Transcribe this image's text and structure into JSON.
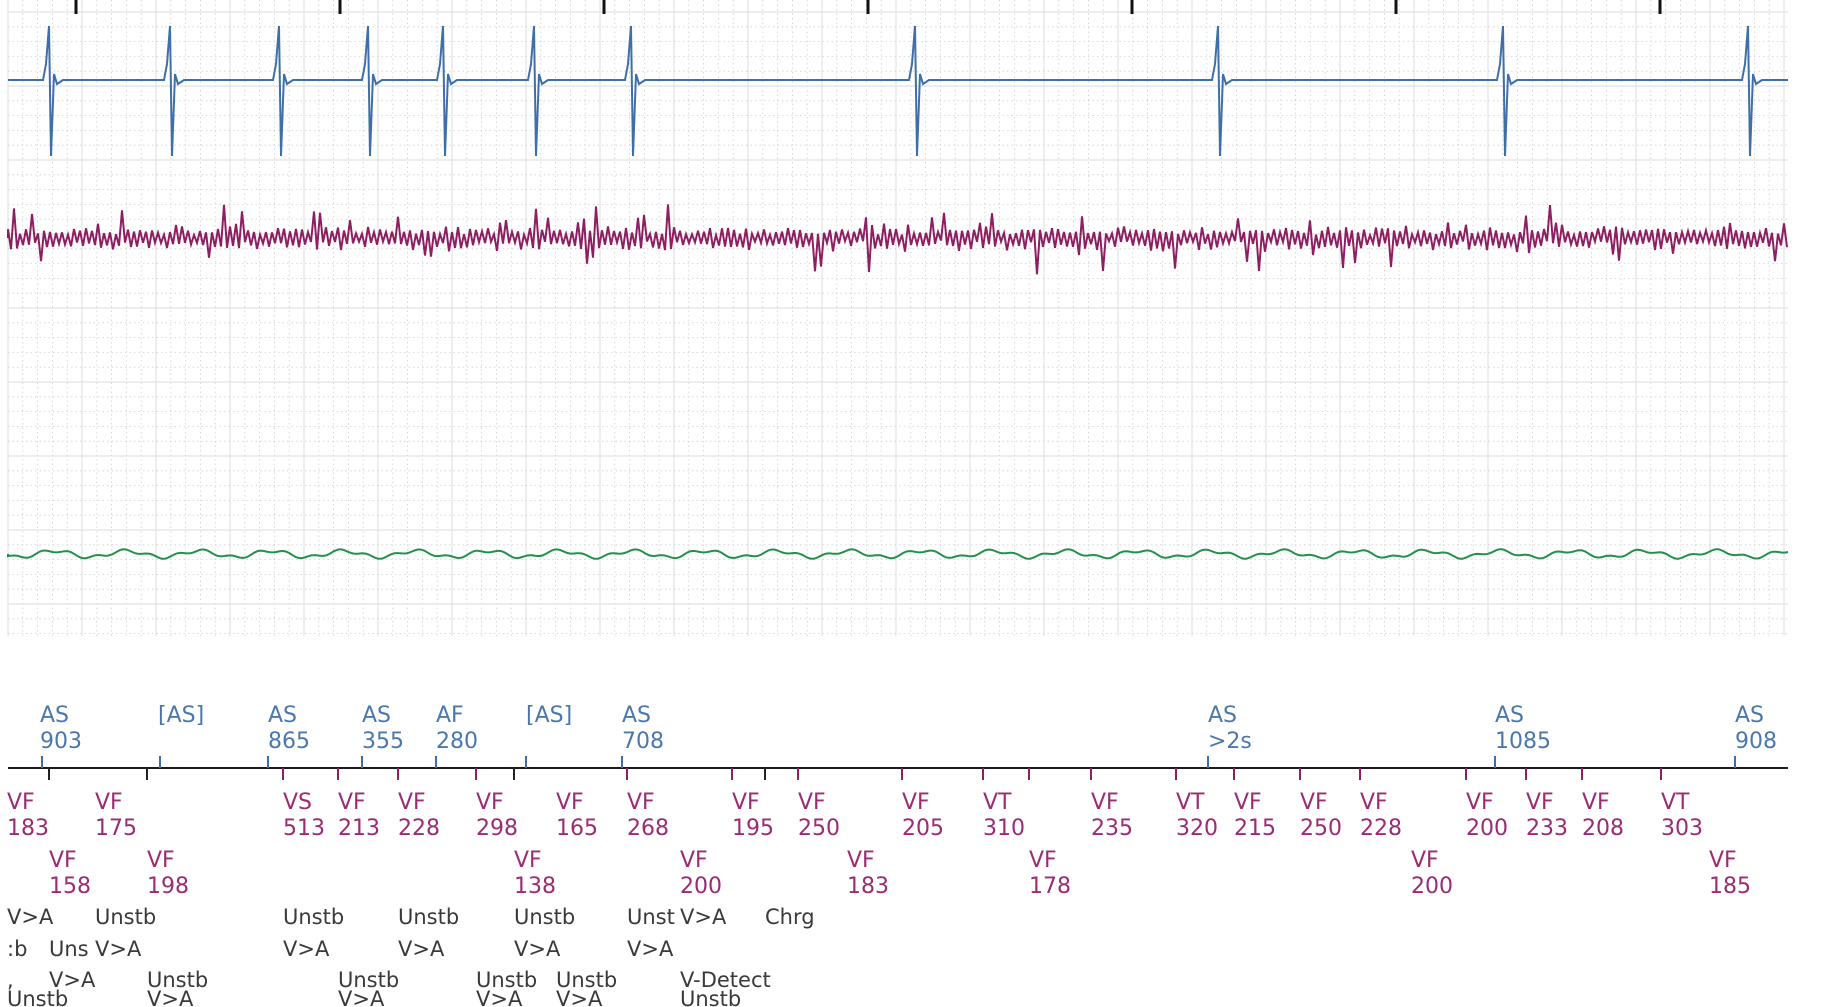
{
  "colors": {
    "atrial": "#3f6fa8",
    "ventricular": "#8e1e62",
    "shock": "#24914a",
    "atrial_text": "#4a78ac",
    "ventricular_text": "#9b2b72",
    "status_text": "#3a3a3a",
    "grid_major": "#e2e2e2",
    "grid_minor": "#d0d0d0",
    "marker_axis": "#1a1a1a"
  },
  "atrial_markers": [
    {
      "code": "AS",
      "interval": "903"
    },
    {
      "code": "[AS]",
      "interval": ""
    },
    {
      "code": "AS",
      "interval": "865"
    },
    {
      "code": "AS",
      "interval": "355"
    },
    {
      "code": "AF",
      "interval": "280"
    },
    {
      "code": "[AS]",
      "interval": ""
    },
    {
      "code": "AS",
      "interval": "708"
    },
    {
      "code": "AS",
      "interval": ">2s"
    },
    {
      "code": "AS",
      "interval": "1085"
    },
    {
      "code": "AS",
      "interval": "908"
    }
  ],
  "ventricular_markers": [
    {
      "code": "VF",
      "interval": "183"
    },
    {
      "code": "VF",
      "interval": "175"
    },
    {
      "code": "VS",
      "interval": "513"
    },
    {
      "code": "VF",
      "interval": "213"
    },
    {
      "code": "VF",
      "interval": "228"
    },
    {
      "code": "VF",
      "interval": "298"
    },
    {
      "code": "VF",
      "interval": "165"
    },
    {
      "code": "VF",
      "interval": "268"
    },
    {
      "code": "VF",
      "interval": "195"
    },
    {
      "code": "VF",
      "interval": "250"
    },
    {
      "code": "VF",
      "interval": "205"
    },
    {
      "code": "VT",
      "interval": "310"
    },
    {
      "code": "VF",
      "interval": "235"
    },
    {
      "code": "VT",
      "interval": "320"
    },
    {
      "code": "VF",
      "interval": "215"
    },
    {
      "code": "VF",
      "interval": "250"
    },
    {
      "code": "VF",
      "interval": "228"
    },
    {
      "code": "VF",
      "interval": "200"
    },
    {
      "code": "VF",
      "interval": "233"
    },
    {
      "code": "VF",
      "interval": "208"
    },
    {
      "code": "VT",
      "interval": "303"
    },
    {
      "code": "VF",
      "interval": "158"
    },
    {
      "code": "VF",
      "interval": "198"
    },
    {
      "code": "VF",
      "interval": "138"
    },
    {
      "code": "VF",
      "interval": "200"
    },
    {
      "code": "VF",
      "interval": "183"
    },
    {
      "code": "VF",
      "interval": "178"
    },
    {
      "code": "VF",
      "interval": "200"
    },
    {
      "code": "VF",
      "interval": "185"
    }
  ],
  "status_rows": [
    [
      "V>A",
      "Unstb",
      "Unstb",
      "Unstb",
      "Unstb",
      "Unst",
      "V>A",
      "Chrg"
    ],
    [
      ":b",
      "Uns",
      "V>A",
      "V>A",
      "V>A",
      "V>A",
      "V>A"
    ],
    [
      ",",
      "V>A",
      "Unstb",
      "Unstb",
      "Unstb",
      "Unstb",
      "V-Detect"
    ],
    [
      "Unstb",
      "V>A",
      "V>A",
      "V>A",
      "V>A",
      "Unstb"
    ]
  ]
}
